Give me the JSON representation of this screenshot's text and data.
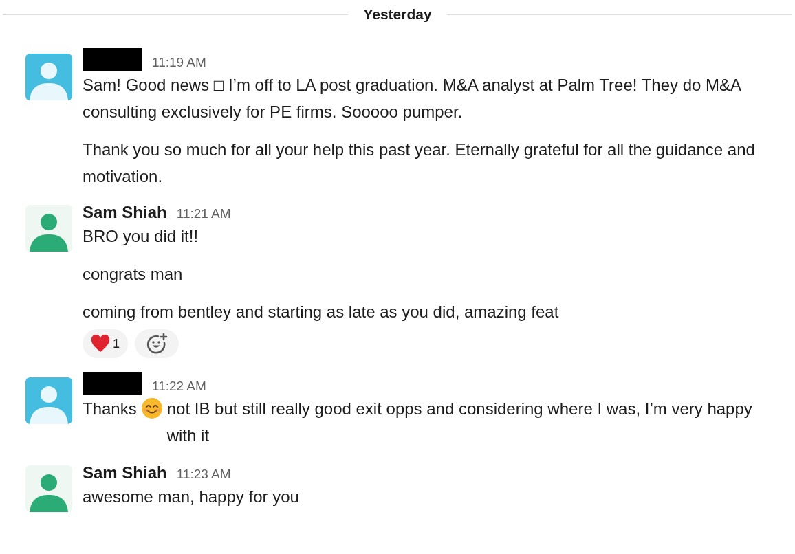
{
  "date_divider": "Yesterday",
  "messages": [
    {
      "author": {
        "kind": "redacted"
      },
      "time": "11:19 AM",
      "avatar": {
        "kind": "filled",
        "color": "#44bde0"
      },
      "paragraphs": [
        [
          {
            "kind": "text",
            "text": "Sam! Good news □ I’m off to LA post graduation. M&A analyst at Palm Tree! They do M&A consulting exclusively for PE firms. Sooooo pumper."
          }
        ],
        [
          {
            "kind": "text",
            "text": "Thank you so much for all your help this past year. Eternally grateful for all the guidance and motivation."
          }
        ]
      ]
    },
    {
      "author": {
        "kind": "name",
        "text": "Sam Shiah"
      },
      "time": "11:21 AM",
      "avatar": {
        "kind": "light",
        "color": "#2bac76"
      },
      "paragraphs": [
        [
          {
            "kind": "text",
            "text": "BRO you did it!!"
          }
        ],
        [
          {
            "kind": "text",
            "text": "congrats man"
          }
        ],
        [
          {
            "kind": "text",
            "text": "coming from bentley and starting as late as you did, amazing feat"
          }
        ]
      ],
      "reactions": [
        {
          "kind": "heart",
          "count": "1"
        }
      ],
      "add_reaction": true
    },
    {
      "author": {
        "kind": "redacted"
      },
      "time": "11:22 AM",
      "avatar": {
        "kind": "filled",
        "color": "#44bde0"
      },
      "paragraphs": [
        [
          {
            "kind": "text",
            "text": "Thanks"
          },
          {
            "kind": "emoji"
          },
          {
            "kind": "text",
            "text": "not IB but still really good exit opps and considering where I was, I’m very happy with it"
          }
        ]
      ]
    },
    {
      "author": {
        "kind": "name",
        "text": "Sam Shiah"
      },
      "time": "11:23 AM",
      "avatar": {
        "kind": "light",
        "color": "#2bac76"
      },
      "paragraphs": [
        [
          {
            "kind": "text",
            "text": "awesome man, happy for you"
          }
        ]
      ]
    }
  ]
}
